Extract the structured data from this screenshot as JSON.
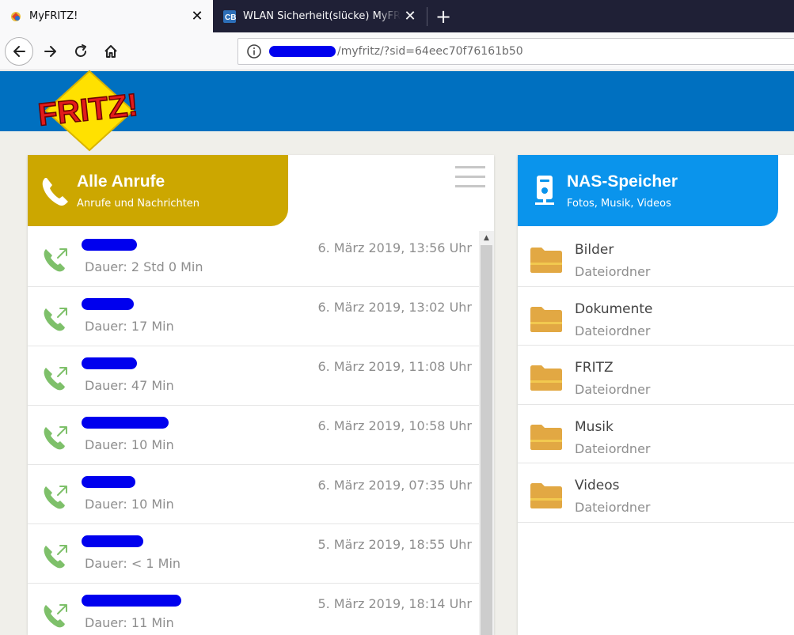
{
  "browser": {
    "tabs": [
      {
        "title": "MyFRITZ!",
        "active": true
      },
      {
        "title": "WLAN Sicherheit(slücke) MyFRITZ",
        "active": false
      }
    ],
    "url_visible": "/myfritz/?sid=64eec70f76161b50"
  },
  "logo": {
    "text": "FRITZ!"
  },
  "calls_card": {
    "title": "Alle Anrufe",
    "subtitle": "Anrufe und Nachrichten",
    "color": "#cca700",
    "items": [
      {
        "duration": "Dauer: 2 Std 0 Min",
        "date": "6. März 2019, 13:56 Uhr"
      },
      {
        "duration": "Dauer: 17 Min",
        "date": "6. März 2019, 13:02 Uhr"
      },
      {
        "duration": "Dauer: 47 Min",
        "date": "6. März 2019, 11:08 Uhr"
      },
      {
        "duration": "Dauer: 10 Min",
        "date": "6. März 2019, 10:58 Uhr"
      },
      {
        "duration": "Dauer: 10 Min",
        "date": "6. März 2019, 07:35 Uhr"
      },
      {
        "duration": "Dauer: < 1 Min",
        "date": "5. März 2019, 18:55 Uhr"
      },
      {
        "duration": "Dauer: 11 Min",
        "date": "5. März 2019, 18:14 Uhr"
      }
    ]
  },
  "nas_card": {
    "title": "NAS-Speicher",
    "subtitle": "Fotos, Musik, Videos",
    "color": "#0a94ec",
    "items": [
      {
        "name": "Bilder",
        "type": "Dateiordner"
      },
      {
        "name": "Dokumente",
        "type": "Dateiordner"
      },
      {
        "name": "FRITZ",
        "type": "Dateiordner"
      },
      {
        "name": "Musik",
        "type": "Dateiordner"
      },
      {
        "name": "Videos",
        "type": "Dateiordner"
      }
    ]
  },
  "colors": {
    "header_blue": "#0070c0",
    "call_icon_green": "#7ec06a",
    "folder_orange": "#e2a843",
    "redaction": "#0000ee"
  }
}
